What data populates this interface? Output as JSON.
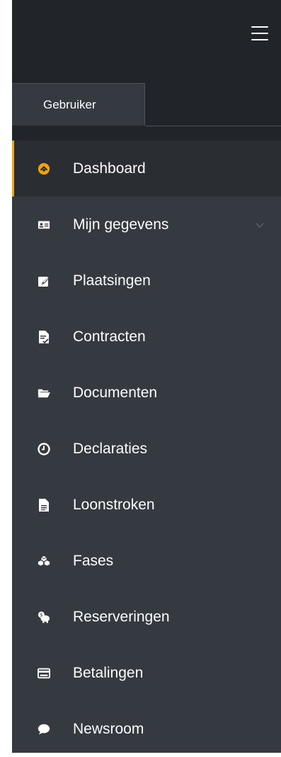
{
  "colors": {
    "accent": "#f0a30a",
    "sidebar_bg": "#343a40",
    "topbar_bg": "#212428"
  },
  "header": {
    "menu_icon": "hamburger-icon"
  },
  "tabs": [
    {
      "label": "Gebruiker",
      "active": true
    }
  ],
  "menu": {
    "items": [
      {
        "label": "Dashboard",
        "icon": "dashboard-gauge-icon",
        "active": true
      },
      {
        "label": "Mijn gegevens",
        "icon": "id-card-icon",
        "has_submenu": true
      },
      {
        "label": "Plaatsingen",
        "icon": "edit-icon"
      },
      {
        "label": "Contracten",
        "icon": "file-signature-icon"
      },
      {
        "label": "Documenten",
        "icon": "folder-open-icon"
      },
      {
        "label": "Declaraties",
        "icon": "clock-icon"
      },
      {
        "label": "Loonstroken",
        "icon": "file-text-icon"
      },
      {
        "label": "Fases",
        "icon": "cubes-icon"
      },
      {
        "label": "Reserveringen",
        "icon": "piggy-bank-icon"
      },
      {
        "label": "Betalingen",
        "icon": "credit-card-icon"
      },
      {
        "label": "Newsroom",
        "icon": "comment-icon"
      }
    ]
  }
}
